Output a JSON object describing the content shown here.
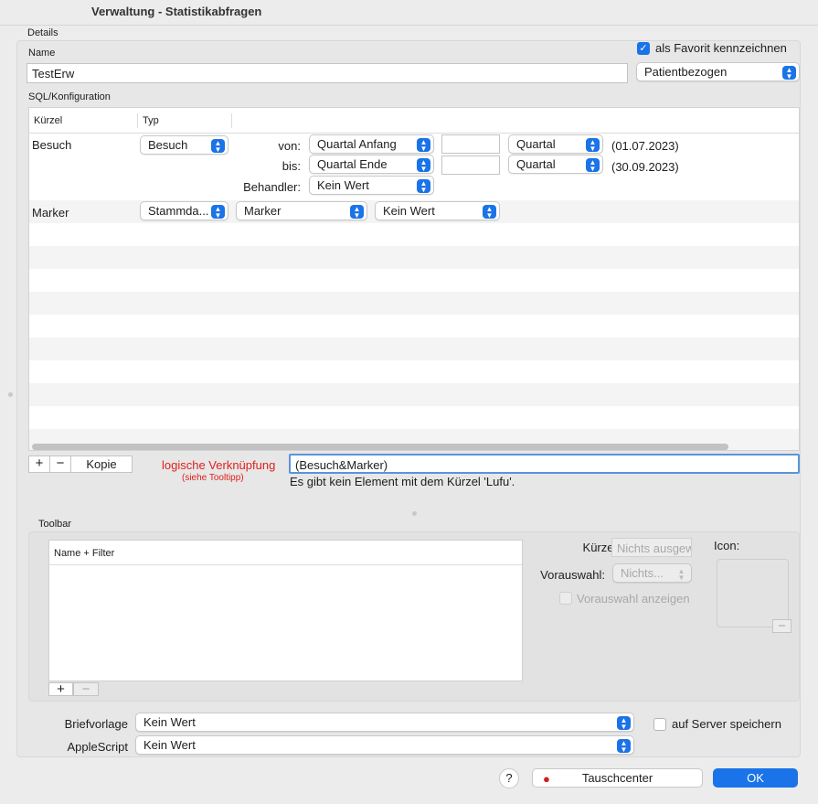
{
  "window": {
    "title": "Verwaltung - Statistikabfragen"
  },
  "details": {
    "section_label": "Details",
    "name_label": "Name",
    "name_value": "TestErw",
    "favorite_label": "als Favorit kennzeichnen",
    "favorite_checked": true,
    "type_select": "Patientbezogen",
    "sql_label": "SQL/Konfiguration"
  },
  "table": {
    "columns": [
      "Kürzel",
      "Typ"
    ],
    "rows": [
      {
        "kuerzel": "Besuch",
        "typ": "Besuch",
        "von_label": "von:",
        "von_select": "Quartal Anfang",
        "von_unit": "Quartal",
        "von_date": "(01.07.2023)",
        "bis_label": "bis:",
        "bis_select": "Quartal Ende",
        "bis_unit": "Quartal",
        "bis_date": "(30.09.2023)",
        "behandler_label": "Behandler:",
        "behandler_select": "Kein Wert"
      },
      {
        "kuerzel": "Marker",
        "typ": "Stammda...",
        "sel1": "Marker",
        "sel2": "Kein Wert"
      }
    ]
  },
  "controls": {
    "add": "+",
    "remove": "−",
    "copy": "Kopie",
    "logic_label": "logische Verknüpfung",
    "logic_hint": "(siehe Tooltipp)",
    "logic_value": "(Besuch&Marker)",
    "error_message": "Es gibt kein Element mit dem Kürzel 'Lufu'."
  },
  "toolbar": {
    "section_label": "Toolbar",
    "list_header": "Name + Filter",
    "kuerzel_label": "Kürzel:",
    "kuerzel_placeholder": "Nichts ausgew",
    "vorauswahl_label": "Vorauswahl:",
    "vorauswahl_value": "Nichts...",
    "show_label": "Vorauswahl anzeigen",
    "icon_label": "Icon:",
    "add": "+",
    "remove": "−",
    "icon_remove": "−"
  },
  "bottom": {
    "briefvorlage_label": "Briefvorlage",
    "briefvorlage_value": "Kein Wert",
    "applescript_label": "AppleScript",
    "applescript_value": "Kein Wert",
    "server_label": "auf Server speichern",
    "help": "?",
    "tauschcenter": "Tauschcenter",
    "ok": "OK"
  },
  "colors": {
    "accent": "#1a73e8",
    "error": "#e0201b"
  }
}
